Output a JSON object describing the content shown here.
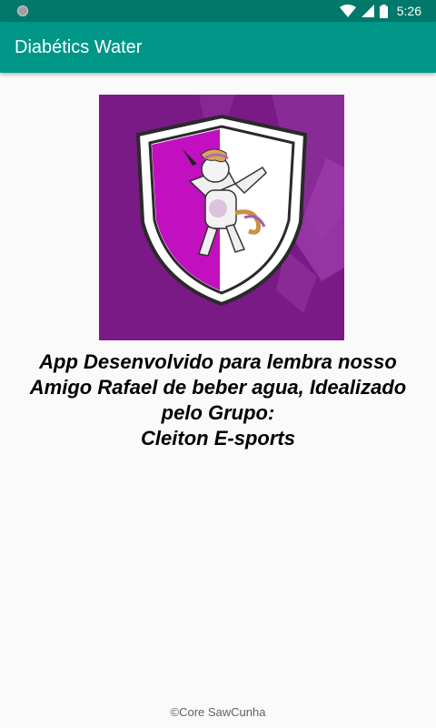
{
  "status_bar": {
    "time": "5:26",
    "icons": [
      "notification-dot-icon",
      "wifi-icon",
      "cellular-signal-icon",
      "battery-icon"
    ]
  },
  "app_bar": {
    "title": "Diabétics Water"
  },
  "main": {
    "logo": {
      "description_icon": "unicorn-shield-logo-icon"
    },
    "message": "App Desenvolvido para lembra nosso\nAmigo Rafael de beber agua, Idealizado\npelo Grupo:\nCleiton E-sports"
  },
  "footer": {
    "copyright": "©Core SawCunha"
  },
  "colors": {
    "status_bar": "#00796b",
    "app_bar": "#009688",
    "background": "#fafafa",
    "logo_purple": "#7a1a86",
    "logo_magenta": "#c20fc0"
  }
}
